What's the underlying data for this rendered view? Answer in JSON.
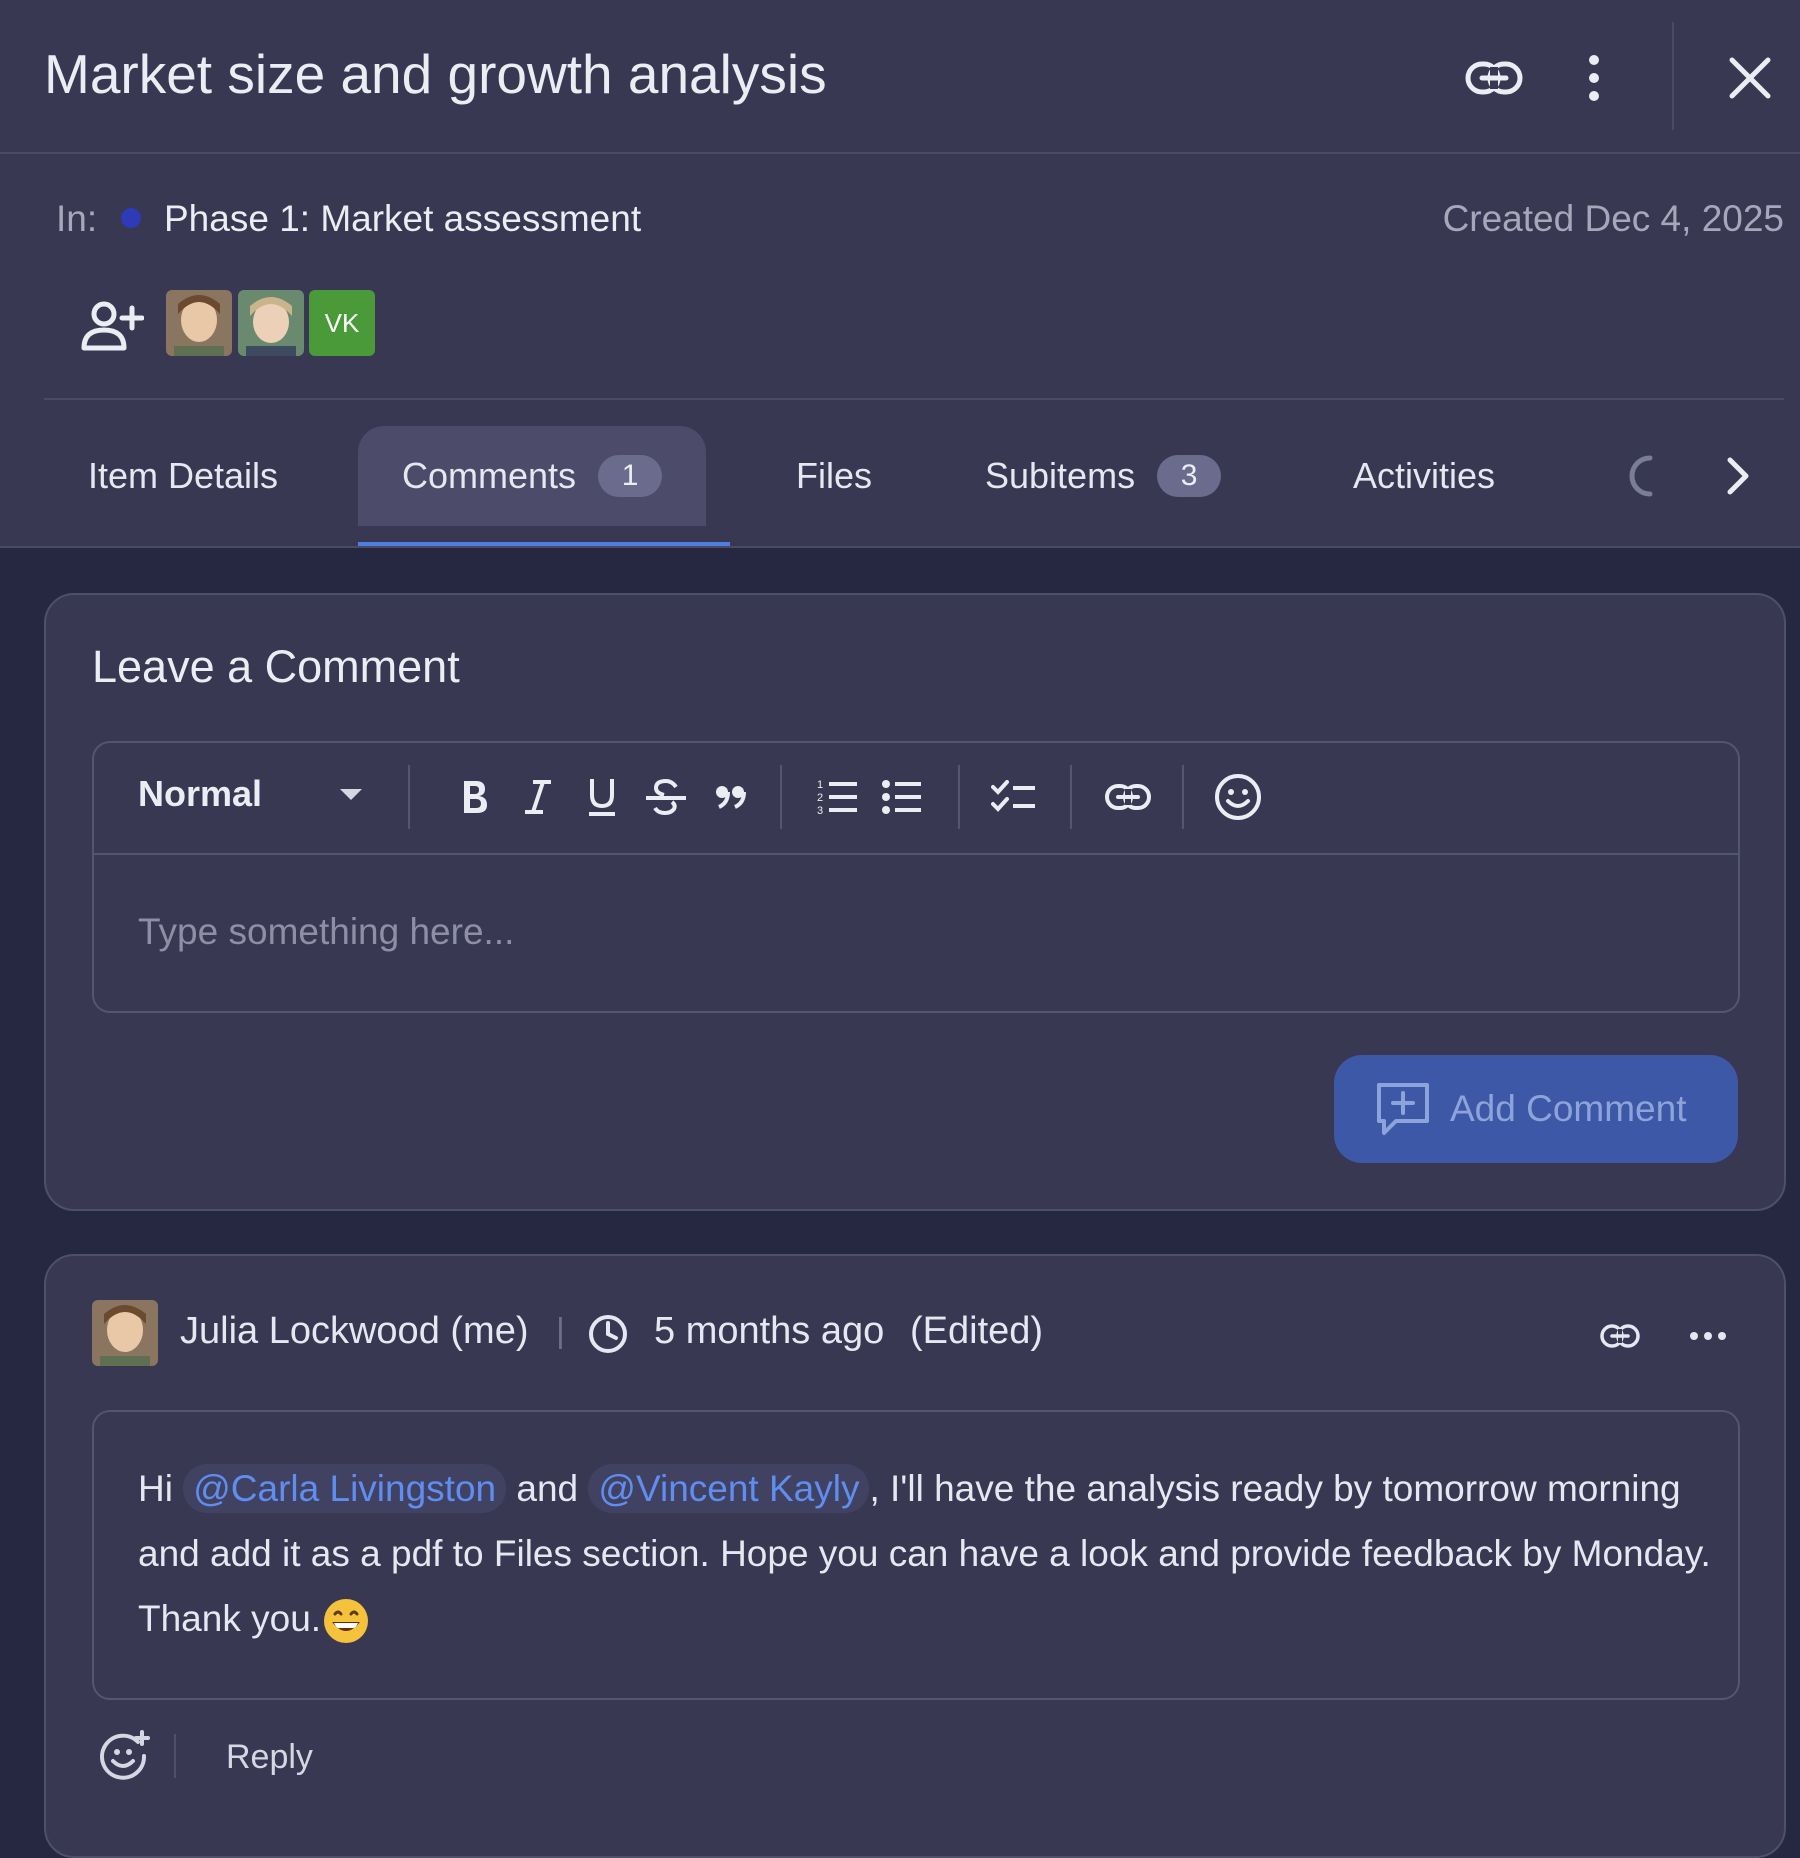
{
  "header": {
    "title": "Market size and growth analysis",
    "icons": [
      "link-icon",
      "more-vertical-icon",
      "close-icon"
    ]
  },
  "meta": {
    "in_label": "In:",
    "phase_name": "Phase 1: Market assessment",
    "phase_color": "#2d3bb8",
    "created": "Created Dec 4, 2025",
    "assignees": [
      {
        "type": "photo",
        "name": "avatar-woman-1"
      },
      {
        "type": "photo",
        "name": "avatar-woman-2"
      },
      {
        "type": "initials",
        "initials": "VK",
        "color": "#4a9a39"
      }
    ]
  },
  "tabs": [
    {
      "label": "Item Details"
    },
    {
      "label": "Comments",
      "badge": "1",
      "active": true
    },
    {
      "label": "Files"
    },
    {
      "label": "Subitems",
      "badge": "3"
    },
    {
      "label": "Activities"
    }
  ],
  "comment_form": {
    "title": "Leave a Comment",
    "format_select": "Normal",
    "placeholder": "Type something here...",
    "submit_label": "Add Comment",
    "toolbar_icons": [
      "bold-icon",
      "italic-icon",
      "underline-icon",
      "strikethrough-icon",
      "quote-icon",
      "ordered-list-icon",
      "bullet-list-icon",
      "checklist-icon",
      "link-icon",
      "emoji-icon"
    ]
  },
  "comment": {
    "author": "Julia Lockwood (me)",
    "separator": "|",
    "time": "5 months ago",
    "edited": "(Edited)",
    "text_hi": "Hi",
    "mention1": "@Carla Livingston",
    "text_and": "and",
    "mention2": "@Vincent Kayly",
    "text_rest": ", I'll have the analysis ready by tomorrow morning and add it as a pdf to Files section. Hope  you can have a look and provide feedback by Monday. Thank you.",
    "reply_label": "Reply"
  },
  "colors": {
    "accent": "#4f7ee0",
    "mention": "#5f8df0",
    "primary_button": "#3e58a8"
  }
}
